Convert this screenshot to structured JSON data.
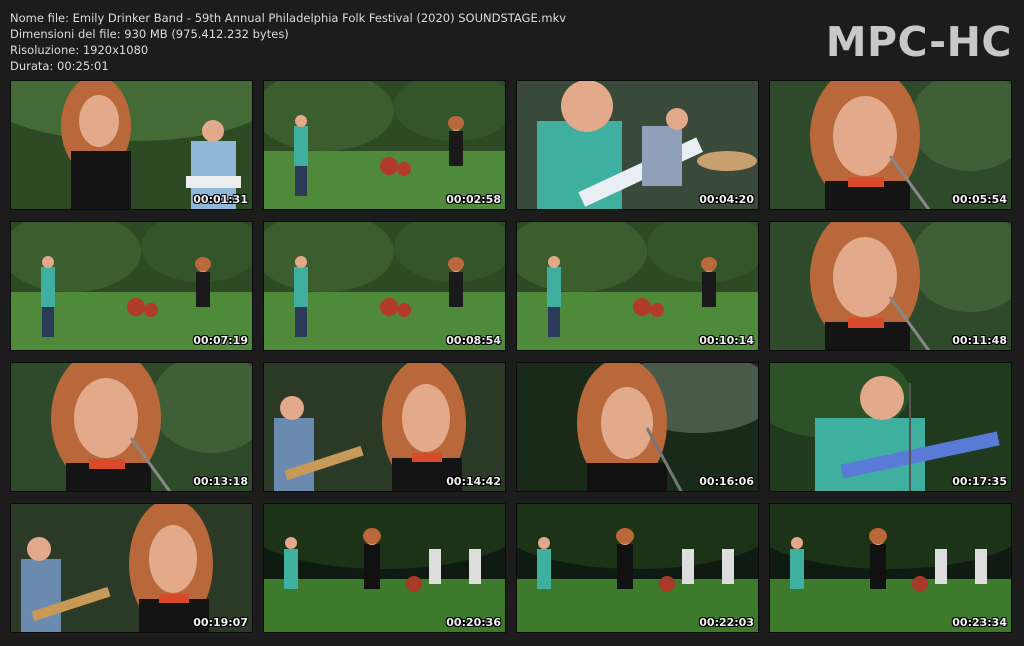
{
  "header": {
    "file_name_line": "Nome file: Emily Drinker Band - 59th Annual Philadelphia Folk Festival (2020) SOUNDSTAGE.mkv",
    "file_size_line": "Dimensioni del file: 930 MB (975.412.232 bytes)",
    "resolution_line": "Risoluzione: 1920x1080",
    "duration_line": "Durata: 00:25:01"
  },
  "logo": {
    "text": "MPC-HC"
  },
  "thumbnails": [
    {
      "timestamp": "00:01:31",
      "scene": "singer-closeup-wide"
    },
    {
      "timestamp": "00:02:58",
      "scene": "band-wide"
    },
    {
      "timestamp": "00:04:20",
      "scene": "guitarist-closeup"
    },
    {
      "timestamp": "00:05:54",
      "scene": "singer-closeup"
    },
    {
      "timestamp": "00:07:19",
      "scene": "band-wide"
    },
    {
      "timestamp": "00:08:54",
      "scene": "band-wide"
    },
    {
      "timestamp": "00:10:14",
      "scene": "band-wide"
    },
    {
      "timestamp": "00:11:48",
      "scene": "singer-closeup"
    },
    {
      "timestamp": "00:13:18",
      "scene": "singer-closeup"
    },
    {
      "timestamp": "00:14:42",
      "scene": "singer-with-guitarist"
    },
    {
      "timestamp": "00:16:06",
      "scene": "singer-closeup-dark"
    },
    {
      "timestamp": "00:17:35",
      "scene": "guitarist-medium"
    },
    {
      "timestamp": "00:19:07",
      "scene": "singer-with-guitarist"
    },
    {
      "timestamp": "00:20:36",
      "scene": "band-wide-night"
    },
    {
      "timestamp": "00:22:03",
      "scene": "band-wide-night"
    },
    {
      "timestamp": "00:23:34",
      "scene": "band-wide-night"
    }
  ],
  "colors": {
    "background": "#1c1c1c",
    "grass": "#4f8a3a",
    "trees": "#2e4a25",
    "skin": "#e2a98a",
    "hair": "#b8683a",
    "shirt_teal": "#3fb0a0"
  }
}
